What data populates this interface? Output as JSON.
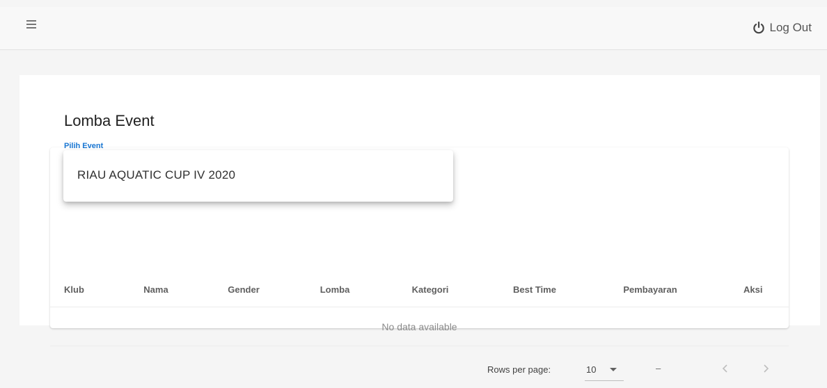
{
  "header": {
    "logout_label": "Log Out"
  },
  "page": {
    "title": "Lomba Event"
  },
  "event_select": {
    "label": "Pilih Event",
    "selected": "RIAU AQUATIC CUP IV 2020"
  },
  "table": {
    "columns": [
      "Klub",
      "Nama",
      "Gender",
      "Lomba",
      "Kategori",
      "Best Time",
      "Pembayaran",
      "Aksi"
    ],
    "empty_text": "No data available",
    "footer": {
      "rows_per_page_label": "Rows per page:",
      "rows_per_page_value": "10",
      "page_range": "–"
    }
  }
}
